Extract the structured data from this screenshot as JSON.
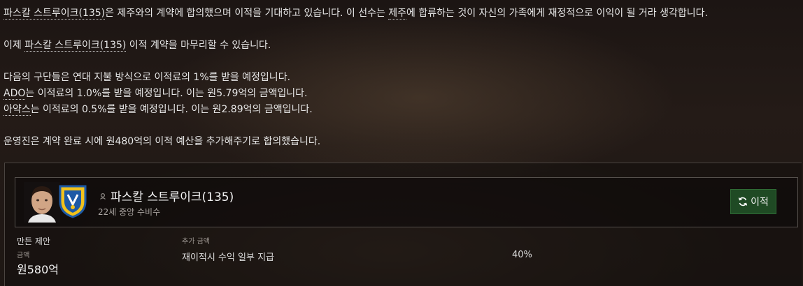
{
  "messages": {
    "line1_prefix": "파스칼 스트루이크(135)",
    "line1_text": "은 제주와의 계약에 합의했으며 이적을 기대하고 있습니다. 이 선수는 ",
    "line1_club": "제주",
    "line1_suffix": "에 합류하는 것이 자신의 가족에게 재정적으로 이익이 될 거라 생각합니다.",
    "line2_prefix": "이제 ",
    "line2_player": "파스칼 스트루이크(135)",
    "line2_suffix": " 이적 계약을 마무리할 수 있습니다.",
    "line3": "다음의 구단들은 연대 지불 방식으로 이적료의 1%를 받을 예정입니다.",
    "line4_club": "ADO",
    "line4_text": "는 이적료의 1.0%를 받을 예정입니다. 이는 원5.79억의 금액입니다.",
    "line5_club": "아약스",
    "line5_text": "는 이적료의 0.5%를 받을 예정입니다. 이는 원2.89억의 금액입니다.",
    "line6": "운영진은 계약 완료 시에 원480억의 이적 예산을 추가해주기로 합의했습니다."
  },
  "card": {
    "player_name": "파스칼 스트루이크(135)",
    "player_desc": "22세 중앙 수비수",
    "transfer_button": "이적",
    "offer_title": "만든 제안",
    "amount_label": "금액",
    "amount_value": "원580억",
    "addon_label": "추가 금액",
    "addon_name": "재이적시 수익 일부 지급",
    "addon_value": "40%"
  },
  "icons": {
    "status": "player-status-icon",
    "transfer": "refresh-icon",
    "crest": "club-crest-icon",
    "face": "player-face-icon"
  },
  "colors": {
    "button_bg": "#1f4a24",
    "crest_yellow": "#f2c21b",
    "crest_blue": "#1d5aa6"
  }
}
